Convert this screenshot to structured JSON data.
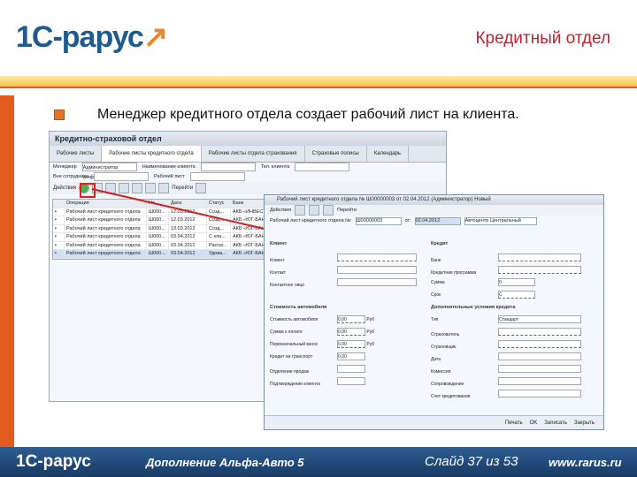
{
  "header": {
    "logo_text": "1С-рарус",
    "title": "Кредитный отдел"
  },
  "slide": {
    "bullet_text": "Менеджер кредитного отдела создает рабочий лист на клиента."
  },
  "app_window": {
    "title": "Кредитно-страховой отдел",
    "tabs": [
      "Рабочие листы",
      "Рабочие листы кредитного отдела",
      "Рабочие листы отдела страхования",
      "Страховые полисы",
      "Календарь"
    ],
    "filters": [
      "Менеджер",
      "Наименование клиента",
      "Тел. клиента",
      "Вне сотрудника",
      "Рабочий лист"
    ],
    "filter_values": {
      "manager": "Администратор (информац"
    },
    "toolbar": {
      "actions": "Действия",
      "find": "Перейти"
    },
    "grid": {
      "headers": [
        "",
        "Операция",
        "Но...",
        "Дата",
        "Статус",
        "Банк"
      ],
      "rows": [
        [
          "",
          "Рабочий лист кредитного отдела",
          "Ш000...",
          "12.03.2012",
          "Созд...",
          "АКБ «ИНВЕСТ..."
        ],
        [
          "",
          "Рабочий лист кредитного отдела",
          "Ш000...",
          "12.03.2012",
          "Созд...",
          "АКБ «ЮГ-БАНК»"
        ],
        [
          "",
          "Рабочий лист кредитного отдела",
          "Ш000...",
          "13.03.2012",
          "Созд...",
          "АКБ «ЮГ-БАНК»"
        ],
        [
          "",
          "Рабочий лист кредитного отдела",
          "Ш000...",
          "03.04.2012",
          "С кла...",
          "АКБ «ЮГ-БАНК»"
        ],
        [
          "",
          "Рабочий лист кредитного отдела",
          "Ш000...",
          "03.04.2012",
          "Рассм...",
          "АКБ «ЮГ-БАНК»"
        ],
        [
          "",
          "Рабочий лист кредитного отдела",
          "Ш000...",
          "03.04.2012",
          "Удова...",
          "АКБ «ЮГ-БАНК»"
        ]
      ]
    }
  },
  "form_window": {
    "title": "Рабочий лист кредитного отдела № Ш00000003 от 02.04.2012 (Администратор) Новый",
    "toolbar": {
      "actions": "Действия",
      "print": "Перейти"
    },
    "number_label": "Рабочий лист кредитного отдела №:",
    "number_value": "Ш00000003",
    "date_label": "от:",
    "date_value": "02.04.2012",
    "organization": "Автоцентр Центральный",
    "section_client": "Клиент",
    "section_credit": "Кредит",
    "section_cost": "Стоимость автомобиля",
    "section_credit_terms": "Дополнительные условия кредита",
    "client_fields": [
      "Клиент",
      "Контакт",
      "Контактное лицо"
    ],
    "credit_fields": [
      "Банк",
      "Кредитная программа",
      "Сумма",
      "Срок"
    ],
    "credit_values": {
      "term": "0",
      "currency": "С"
    },
    "cost_fields": [
      "Стоимость автомобиля",
      "Сумма к оплате",
      "Первоначальный взнос",
      "Кредит на транспорт",
      "Отделение продаж",
      "Подтверждение клиента"
    ],
    "cost_values": [
      "0,00",
      "0,00",
      "0,00",
      "0,00"
    ],
    "cost_currency": "Руб",
    "terms_fields": [
      "Тип",
      "Страхователь",
      "Страховщик",
      "Дата",
      "Комиссия",
      "Сопровождение",
      "Счет кредитования"
    ],
    "terms_values": {
      "type": "Стандарт"
    },
    "buttons": {
      "print": "Печать",
      "ok": "OK",
      "save": "Записать",
      "close": "Закрыть"
    }
  },
  "footer": {
    "logo_text": "1С-рарус",
    "product": "Дополнение Альфа-Авто 5",
    "slide_counter": "Слайд 37 из 53",
    "url": "www.rarus.ru"
  }
}
